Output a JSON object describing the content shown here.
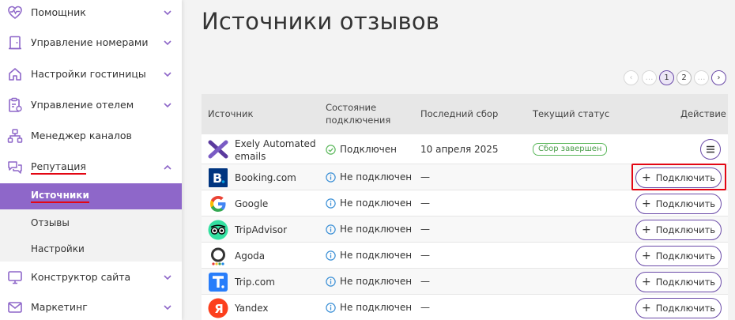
{
  "sidebar": {
    "items": [
      {
        "label": "Помощник",
        "icon": "heart-pulse-icon"
      },
      {
        "label": "Управление номерами",
        "icon": "door-icon"
      },
      {
        "label": "Настройки гостиницы",
        "icon": "house-icon"
      },
      {
        "label": "Управление отелем",
        "icon": "clipboard-gear-icon"
      },
      {
        "label": "Менеджер каналов",
        "icon": "hierarchy-icon"
      },
      {
        "label": "Репутация",
        "icon": "chat-bubbles-icon"
      },
      {
        "label": "Конструктор сайта",
        "icon": "monitor-icon"
      },
      {
        "label": "Маркетинг",
        "icon": "envelope-icon"
      }
    ],
    "sub_items": [
      {
        "label": "Источники"
      },
      {
        "label": "Отзывы"
      },
      {
        "label": "Настройки"
      }
    ]
  },
  "page": {
    "title": "Источники отзывов"
  },
  "pagination": {
    "pages": [
      "1",
      "2"
    ],
    "current": "1",
    "ellipsis": "…",
    "prev_glyph": "‹",
    "next_glyph": "›"
  },
  "table": {
    "headers": {
      "source": "Источник",
      "state_line1": "Состояние",
      "state_line2": "подключения",
      "last_sync": "Последний сбор",
      "status": "Текущий статус",
      "action": "Действие"
    },
    "rows": [
      {
        "name_line1": "Exely Automated",
        "name_line2": "emails",
        "state": "Подключен",
        "last_sync": "10 апреля 2025",
        "status": "Сбор завершен",
        "logo": "exely-logo-icon"
      },
      {
        "name": "Booking.com",
        "state": "Не подключен",
        "last_sync": "—",
        "action": "Подключить",
        "logo": "booking-logo-icon"
      },
      {
        "name": "Google",
        "state": "Не подключен",
        "last_sync": "—",
        "action": "Подключить",
        "logo": "google-logo-icon"
      },
      {
        "name": "TripAdvisor",
        "state": "Не подключен",
        "last_sync": "—",
        "action": "Подключить",
        "logo": "tripadvisor-logo-icon"
      },
      {
        "name": "Agoda",
        "state": "Не подключен",
        "last_sync": "—",
        "action": "Подключить",
        "logo": "agoda-logo-icon"
      },
      {
        "name": "Trip.com",
        "state": "Не подключен",
        "last_sync": "—",
        "action": "Подключить",
        "logo": "tripcom-logo-icon"
      },
      {
        "name": "Yandex",
        "state": "Не подключен",
        "last_sync": "—",
        "action": "Подключить",
        "logo": "yandex-logo-icon"
      }
    ]
  },
  "colors": {
    "accent": "#6a4aa8",
    "active_sub_bg": "#8e67c9",
    "highlight": "#e30613",
    "success": "#5cb85c",
    "info": "#3a8fd6"
  }
}
